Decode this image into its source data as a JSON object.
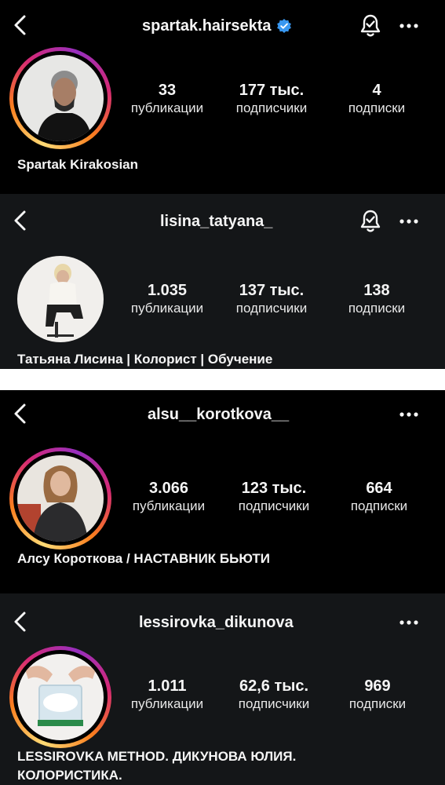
{
  "profiles": [
    {
      "username": "spartak.hairsekta",
      "verified": true,
      "has_bell": true,
      "has_story_ring": true,
      "stats": [
        {
          "value": "33",
          "label": "публикации"
        },
        {
          "value": "177 тыс.",
          "label": "подписчики"
        },
        {
          "value": "4",
          "label": "подписки"
        }
      ],
      "full_name": "Spartak Kirakosian"
    },
    {
      "username": "lisina_tatyana_",
      "verified": false,
      "has_bell": true,
      "has_story_ring": false,
      "stats": [
        {
          "value": "1.035",
          "label": "публикации"
        },
        {
          "value": "137 тыс.",
          "label": "подписчики"
        },
        {
          "value": "138",
          "label": "подписки"
        }
      ],
      "full_name": "Татьяна Лисина | Колорист | Обучение"
    },
    {
      "username": "alsu__korotkova__",
      "verified": false,
      "has_bell": false,
      "has_story_ring": true,
      "stats": [
        {
          "value": "3.066",
          "label": "публикации"
        },
        {
          "value": "123 тыс.",
          "label": "подписчики"
        },
        {
          "value": "664",
          "label": "подписки"
        }
      ],
      "full_name": "Алсу Короткова / НАСТАВНИК БЬЮТИ"
    },
    {
      "username": "lessirovka_dikunova",
      "verified": false,
      "has_bell": false,
      "has_story_ring": true,
      "stats": [
        {
          "value": "1.011",
          "label": "публикации"
        },
        {
          "value": "62,6 тыс.",
          "label": "подписчики"
        },
        {
          "value": "969",
          "label": "подписки"
        }
      ],
      "full_name": "LESSIROVKA METHOD. ДИКУНОВА ЮЛИЯ.\nКОЛОРИСТИКА."
    }
  ],
  "colors": {
    "background": "#000000",
    "alt_background": "#141618",
    "text": "#f5f5f5",
    "verified_badge": "#3897f0",
    "story_ring": [
      "#feda75",
      "#fa7e1e",
      "#d62976",
      "#962fbf"
    ]
  },
  "icons": {
    "back": "chevron-left-icon",
    "verified": "verified-badge-icon",
    "bell": "notification-bell-icon",
    "more": "more-dots-icon"
  }
}
